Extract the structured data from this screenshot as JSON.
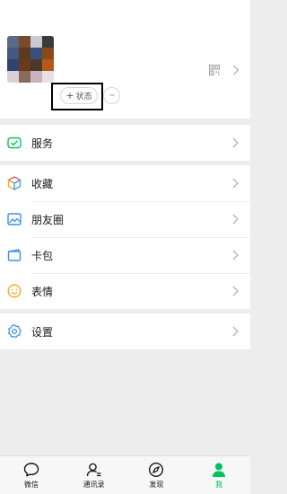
{
  "profile": {
    "status_plus": "+",
    "status_label": "状态",
    "more_label": "···",
    "avatar_colors": [
      "#5a6b8a",
      "#7a4a2a",
      "#c9c9d2",
      "#3a3a3a",
      "#46587e",
      "#5b3a22",
      "#3c4f7a",
      "#8a4a18",
      "#2f4470",
      "#6a3a1e",
      "#4a3a2a",
      "#b45a18",
      "#d9d0d6",
      "#8a6a5a",
      "#c9b3bd",
      "#e6e0e4"
    ]
  },
  "menu": {
    "services": "服务",
    "favorites": "收藏",
    "moments": "朋友圈",
    "cards": "卡包",
    "stickers": "表情",
    "settings": "设置"
  },
  "tabs": [
    {
      "label": "微信",
      "icon": "chat-icon"
    },
    {
      "label": "通讯录",
      "icon": "contacts-icon"
    },
    {
      "label": "发现",
      "icon": "discover-icon"
    },
    {
      "label": "我",
      "icon": "me-icon",
      "active": true
    }
  ],
  "colors": {
    "accent": "#07c160",
    "background": "#ededed"
  }
}
